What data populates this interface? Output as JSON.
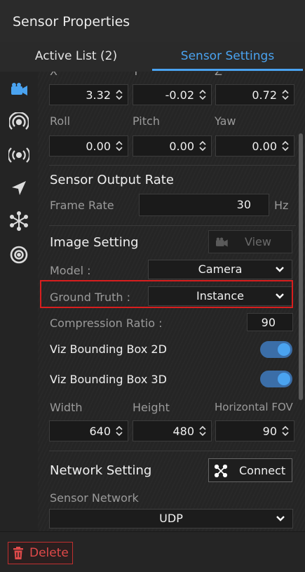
{
  "header": {
    "title": "Sensor Properties"
  },
  "tabs": [
    {
      "label": "Active List  (2)"
    },
    {
      "label": "Sensor Settings"
    }
  ],
  "position": {
    "labels": [
      "X",
      "Y",
      "Z"
    ],
    "values": [
      "3.32",
      "-0.02",
      "0.72"
    ]
  },
  "rotation": {
    "labels": [
      "Roll",
      "Pitch",
      "Yaw"
    ],
    "values": [
      "0.00",
      "0.00",
      "0.00"
    ]
  },
  "output_rate": {
    "title": "Sensor Output Rate",
    "frame_rate_label": "Frame Rate",
    "frame_rate_value": "30",
    "unit": "Hz"
  },
  "image_setting": {
    "title": "Image Setting",
    "view_label": "View",
    "model_label": "Model :",
    "model_value": "Camera",
    "ground_truth_label": "Ground Truth :",
    "ground_truth_value": "Instance",
    "compression_label": "Compression Ratio :",
    "compression_value": "90",
    "bbox2d_label": "Viz Bounding Box 2D",
    "bbox3d_label": "Viz Bounding Box 3D"
  },
  "resolution": {
    "labels": [
      "Width",
      "Height",
      "Horizontal FOV"
    ],
    "values": [
      "640",
      "480",
      "90"
    ]
  },
  "network": {
    "title": "Network Setting",
    "connect_label": "Connect",
    "sensor_network_label": "Sensor Network",
    "sensor_network_value": "UDP"
  },
  "footer": {
    "delete_label": "Delete"
  },
  "colors": {
    "accent": "#4aa3f0",
    "highlight": "#d81e1e",
    "danger": "#e04a4a"
  },
  "sidebar_icons": [
    "camera-icon",
    "radar-icon",
    "broadcast-icon",
    "navigation-arrow-icon",
    "network-node-icon",
    "target-icon"
  ]
}
